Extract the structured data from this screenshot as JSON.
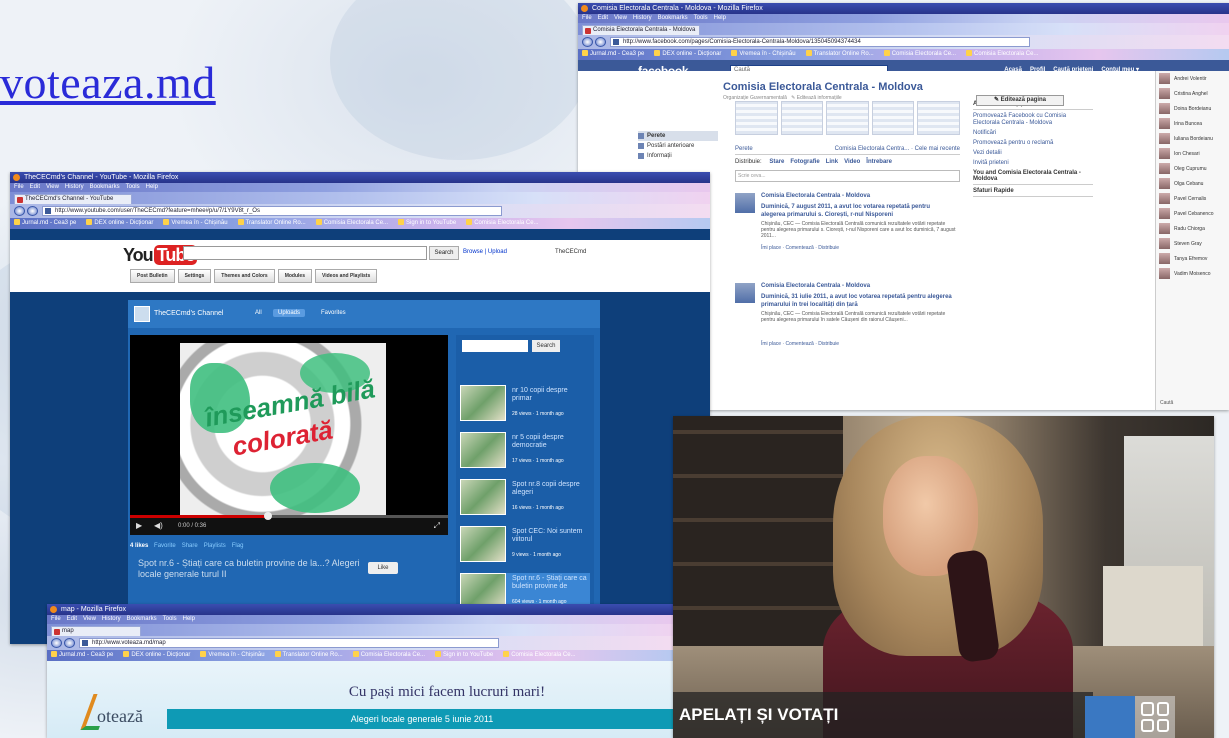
{
  "site_link": "voteaza.md",
  "facebook": {
    "window_title": "Comisia Electorala Centrala - Moldova - Mozilla Firefox",
    "menu": [
      "File",
      "Edit",
      "View",
      "History",
      "Bookmarks",
      "Tools",
      "Help"
    ],
    "tab": "Comisia Electorala Centrala - Moldova",
    "url": "http://www.facebook.com/pages/Comisia-Electorala-Centrala-Moldova/135045094374434",
    "bookmarks": [
      "Jurnal.md - Cea3 pe",
      "DEX online - Dicționar",
      "Vremea în - Chișinău",
      "Translator Online Ro...",
      "Comisia Electorala Ce...",
      "Comisia Electorala Ce..."
    ],
    "logo": "facebook",
    "search_placeholder": "Caută",
    "topnav": [
      "Acasă",
      "Profil",
      "Caută prieteni",
      "Contul meu ▾"
    ],
    "page_title": "Comisia Electorala Centrala - Moldova",
    "page_sub": "Organizație Guvernamentală",
    "edit_info": "✎ Editează informațiile",
    "edit_page": "✎ Editează pagina",
    "side": [
      "Perete",
      "Postări anterioare",
      "Informații"
    ],
    "wall_tabs": [
      "Perete",
      "Comisia Electorala Centra... · Cele mai recente"
    ],
    "share_label": "Distribuie:",
    "share_items": [
      "Stare",
      "Fotografie",
      "Link",
      "Video",
      "Întrebare"
    ],
    "write_placeholder": "Scrie ceva...",
    "posts": [
      {
        "name": "Comisia Electorala Centrala - Moldova",
        "head": "Duminică, 7 august 2011, a avut loc votarea repetată pentru alegerea primarului s. Ciorești, r-nul Nisporeni",
        "text": "Chișinău, CEC — Comisia Electorală Centrală comunică rezultatele votării repetate pentru alegerea primarului s. Ciorești, r-nul Nisporeni care a avut loc duminică, 7 august 2011...",
        "meta": "Îmi place · Comentează · Distribuie"
      },
      {
        "name": "Comisia Electorala Centrala - Moldova",
        "head": "Duminică, 31 iulie 2011, a avut loc votarea repetată pentru alegerea primarului în trei localități din țară",
        "text": "Chișinău, CEC — Comisia Electorală Centrală comunică rezultatele votării repetate pentru alegerea primarului în satele Câușeni din raionul Câușeni...",
        "meta": "Îmi place · Comentează · Distribuie"
      }
    ],
    "right_header": "Administratori (1)",
    "right_links": [
      "Promovează Facebook cu Comisia Electorala Centrala - Moldova",
      "Notificări",
      "Promovează pentru o reclamă",
      "Vezi detalii",
      "Invită prieteni"
    ],
    "right_header2": "You and Comisia Electorala Centrala - Moldova",
    "right_header3": "Sfaturi Rapide",
    "chat": [
      "Andrei Volentir",
      "Cristina Anghel",
      "Doina Bordeianu",
      "Irina Buncea",
      "Iuliana Bordeianu",
      "Ion Chesari",
      "Oleg Cuprumu",
      "Olga Cebanu",
      "Pavel Cernalis",
      "Pavel Cebanenco",
      "Radu Chiorga",
      "Steven Gray",
      "Tanya Efremov",
      "Vadim Moisenco"
    ],
    "chat_search": "Caută"
  },
  "youtube": {
    "window_title": "TheCECmd's Channel - YouTube - Mozilla Firefox",
    "menu": [
      "File",
      "Edit",
      "View",
      "History",
      "Bookmarks",
      "Tools",
      "Help"
    ],
    "tab": "TheCECmd's Channel - YouTube",
    "url": "http://www.youtube.com/user/TheCECmd?feature=mhee#p/u/7/1Y9V8t_r_Os",
    "bookmarks": [
      "Jurnal.md - Cea3 pe",
      "DEX online - Dicționar",
      "Vremea în - Chișinău",
      "Translator Online Ro...",
      "Comisia Electorala Ce...",
      "Sign in to YouTube",
      "Comisia Electorala Ce..."
    ],
    "search_button": "Search",
    "links": "Browse | Upload",
    "user": "TheCECmd",
    "buttons": [
      "Post Bulletin",
      "Settings",
      "Themes and Colors",
      "Modules",
      "Videos and Playlists"
    ],
    "channel_name": "TheCECmd's Channel",
    "tabs": [
      "All",
      "Uploads",
      "Favorites"
    ],
    "caption1": "înseamnă bilă",
    "caption2": "colorată",
    "time": "0:00 / 0:36",
    "info_likes": "4 likes",
    "info_links": [
      "Favorite",
      "Share",
      "Playlists",
      "Flag"
    ],
    "description": "Spot nr.6 - Știați care ca buletin provine de la...? Alegeri locale generale turul II",
    "like": "Like",
    "list_search_btn": "Search",
    "videos": [
      {
        "title": "nr 10 copii despre primar",
        "views": "28 views · 1 month ago"
      },
      {
        "title": "nr 5 copii despre democratie",
        "views": "17 views · 1 month ago"
      },
      {
        "title": "Spot nr.8 copii despre alegeri",
        "views": "16 views · 1 month ago"
      },
      {
        "title": "Spot CEC: Noi suntem viitorul",
        "views": "9 views · 1 month ago"
      },
      {
        "title": "Spot nr.6 - Știați care ca buletin provine de",
        "views": "604 views · 1 month ago"
      }
    ]
  },
  "voteaza": {
    "window_title": "map - Mozilla Firefox",
    "menu": [
      "File",
      "Edit",
      "View",
      "History",
      "Bookmarks",
      "Tools",
      "Help"
    ],
    "tab": "map",
    "url": "http://www.voteaza.md/map",
    "bookmarks": [
      "Jurnal.md - Cea3 pe",
      "DEX online - Dicționar",
      "Vremea în - Chișinău",
      "Translator Online Ro...",
      "Comisia Electorala Ce...",
      "Sign in to YouTube",
      "Comisia Electorala Ce..."
    ],
    "logo": "otează",
    "slogan": "Cu pași mici facem lucruri mari!",
    "banner": "Alegeri locale generale 5 iunie 2011"
  },
  "video_caption": "APELAȚI ȘI VOTAȚI"
}
